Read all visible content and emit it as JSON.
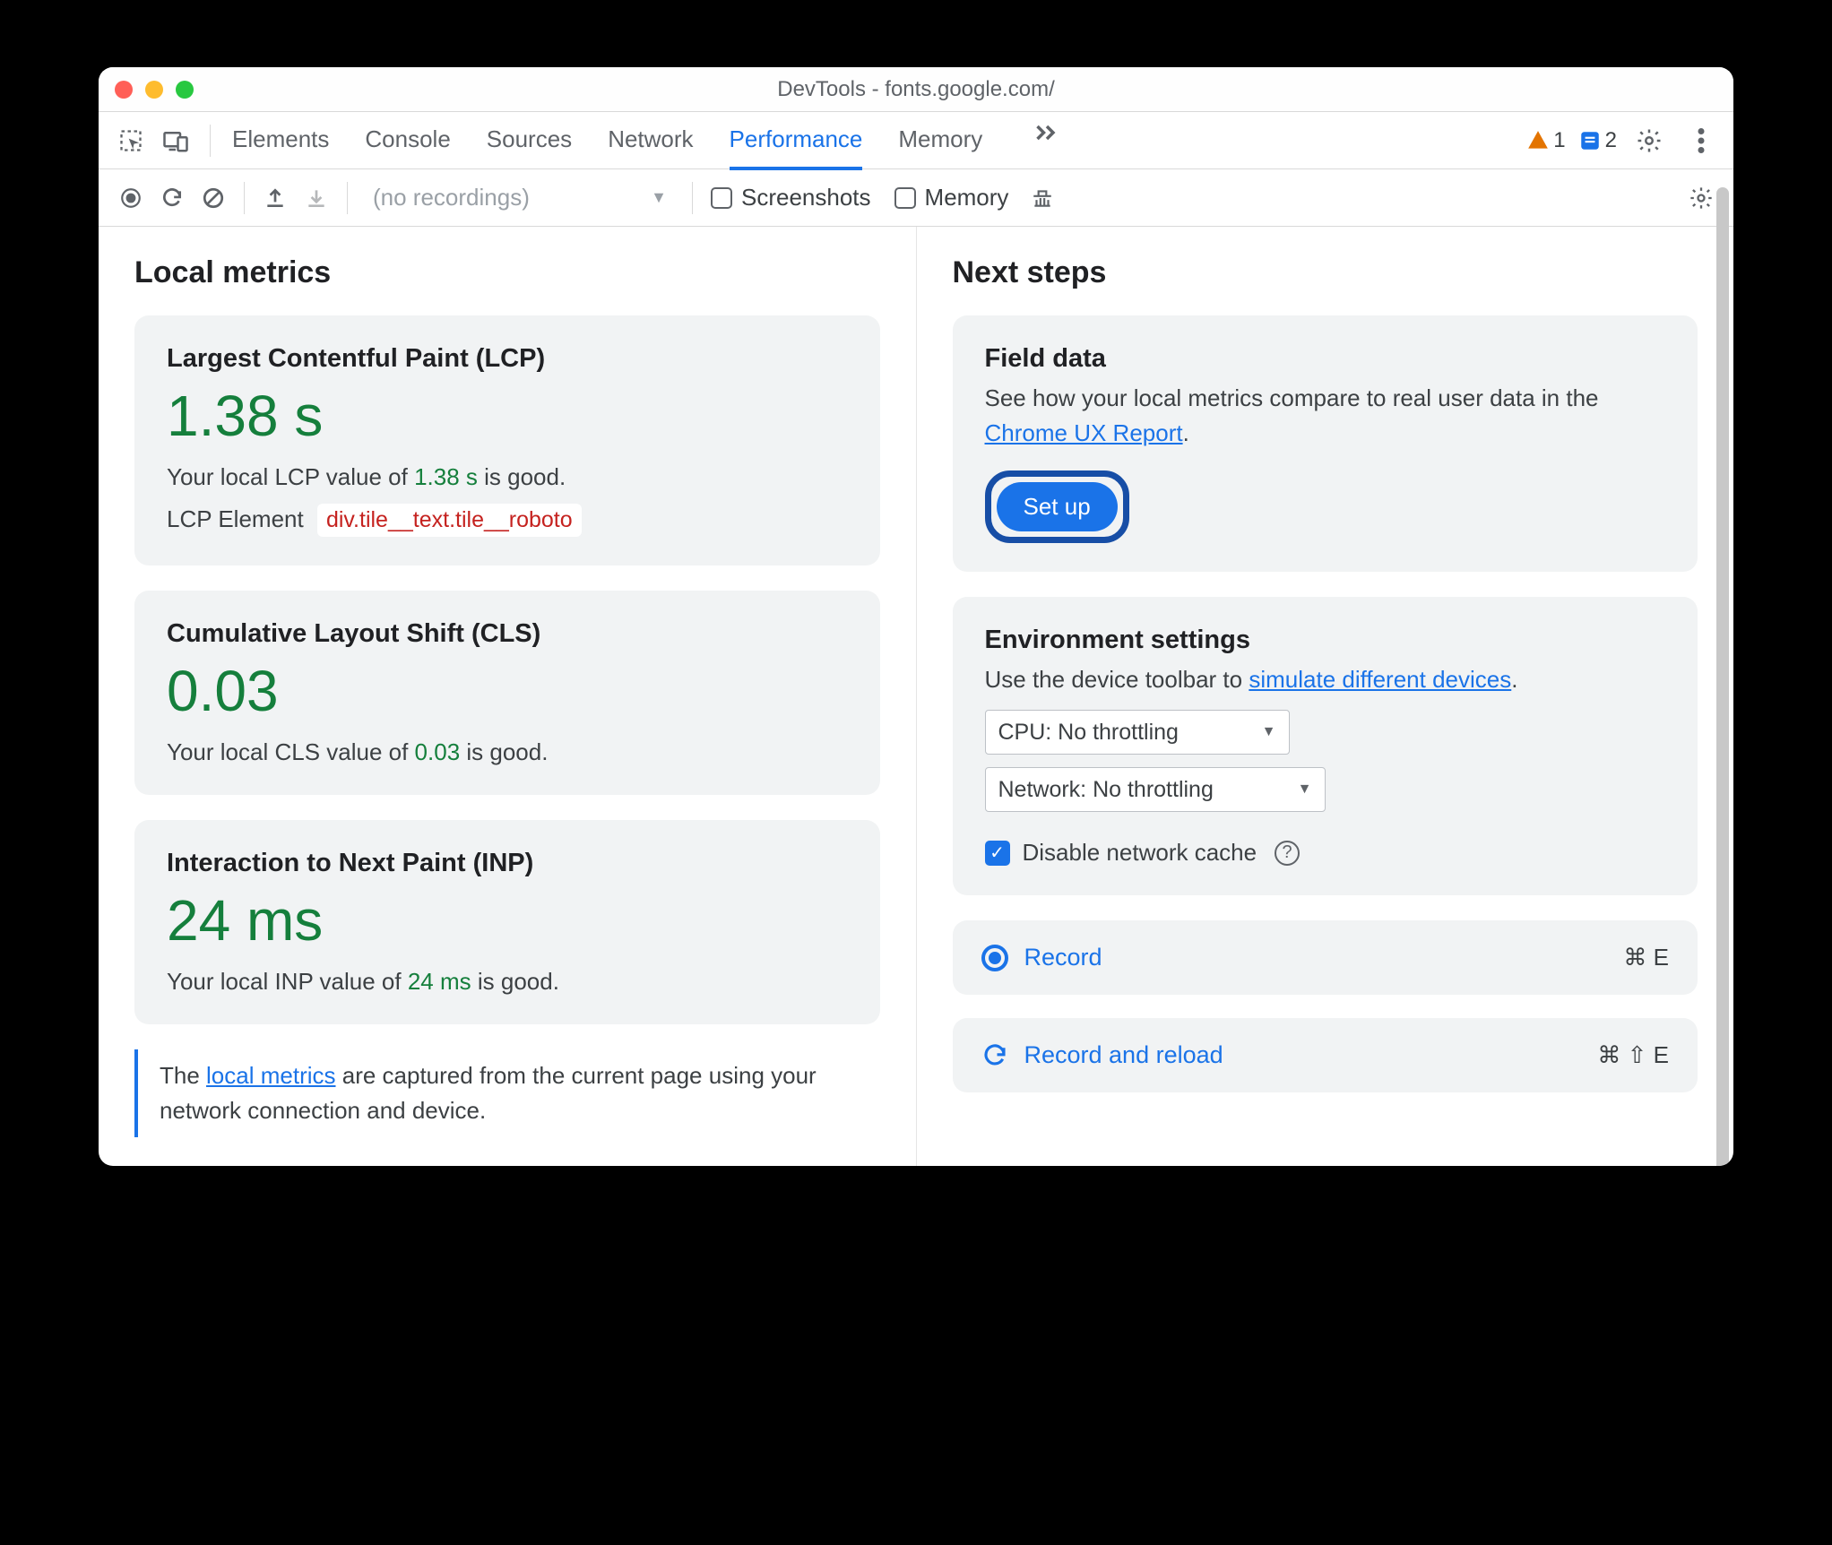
{
  "window": {
    "title": "DevTools - fonts.google.com/"
  },
  "tabs": {
    "items": [
      "Elements",
      "Console",
      "Sources",
      "Network",
      "Performance",
      "Memory"
    ],
    "active": "Performance",
    "overflow_icon": "chevrons-right-icon"
  },
  "badges": {
    "warnings": "1",
    "issues": "2"
  },
  "toolbar": {
    "recordings_placeholder": "(no recordings)",
    "screenshots_label": "Screenshots",
    "memory_label": "Memory"
  },
  "left": {
    "heading": "Local metrics",
    "lcp": {
      "title": "Largest Contentful Paint (LCP)",
      "value": "1.38 s",
      "desc_pre": "Your local LCP value of ",
      "desc_val": "1.38 s",
      "desc_post": " is good.",
      "element_label": "LCP Element",
      "element_chip": "div.tile__text.tile__roboto"
    },
    "cls": {
      "title": "Cumulative Layout Shift (CLS)",
      "value": "0.03",
      "desc_pre": "Your local CLS value of ",
      "desc_val": "0.03",
      "desc_post": " is good."
    },
    "inp": {
      "title": "Interaction to Next Paint (INP)",
      "value": "24 ms",
      "desc_pre": "Your local INP value of ",
      "desc_val": "24 ms",
      "desc_post": " is good."
    },
    "note_pre": "The ",
    "note_link": "local metrics",
    "note_post": " are captured from the current page using your network connection and device."
  },
  "right": {
    "heading": "Next steps",
    "field": {
      "title": "Field data",
      "desc_pre": "See how your local metrics compare to real user data in the ",
      "desc_link": "Chrome UX Report",
      "desc_post": ".",
      "button": "Set up"
    },
    "env": {
      "title": "Environment settings",
      "desc_pre": "Use the device toolbar to ",
      "desc_link": "simulate different devices",
      "desc_post": ".",
      "cpu_select": "CPU: No throttling",
      "net_select": "Network: No throttling",
      "disable_cache": "Disable network cache"
    },
    "record": {
      "label": "Record",
      "shortcut": "⌘ E"
    },
    "reload": {
      "label": "Record and reload",
      "shortcut": "⌘ ⇧ E"
    }
  }
}
